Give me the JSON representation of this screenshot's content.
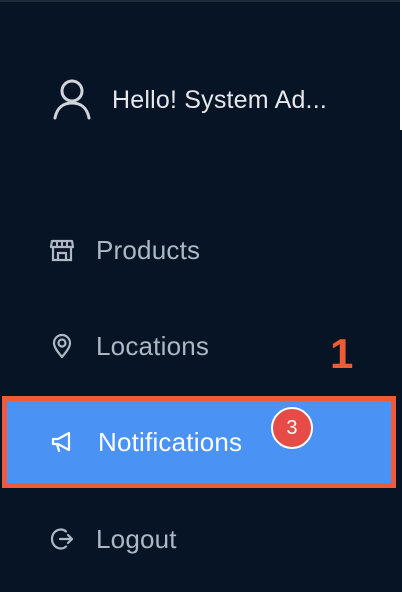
{
  "profile": {
    "greeting": "Hello! System Ad..."
  },
  "nav": {
    "products_label": "Products",
    "locations_label": "Locations",
    "notifications_label": "Notifications",
    "notifications_badge": "3",
    "logout_label": "Logout"
  },
  "annotation": {
    "label": "1"
  },
  "colors": {
    "background": "#071426",
    "selected": "#4a93f5",
    "highlight_border": "#ee5a3a",
    "badge": "#e74b48"
  },
  "icons": {
    "profile": "user-icon",
    "products": "store-icon",
    "locations": "map-pin-icon",
    "notifications": "megaphone-icon",
    "logout": "logout-icon"
  }
}
